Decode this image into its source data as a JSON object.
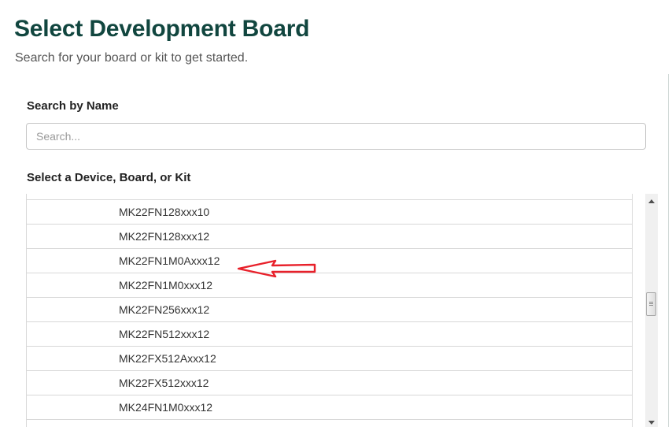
{
  "header": {
    "title": "Select Development Board",
    "subtitle": "Search for your board or kit to get started."
  },
  "search": {
    "label": "Search by Name",
    "placeholder": "Search...",
    "value": ""
  },
  "device_section": {
    "label": "Select a Device, Board, or Kit",
    "items": [
      "MK22FN128xxx10",
      "MK22FN128xxx12",
      "MK22FN1M0Axxx12",
      "MK22FN1M0xxx12",
      "MK22FN256xxx12",
      "MK22FN512xxx12",
      "MK22FX512Axxx12",
      "MK22FX512xxx12",
      "MK24FN1M0xxx12"
    ]
  },
  "annotation": {
    "icon": "left-arrow-icon",
    "color": "#e8202a"
  },
  "colors": {
    "title": "#11463f"
  }
}
